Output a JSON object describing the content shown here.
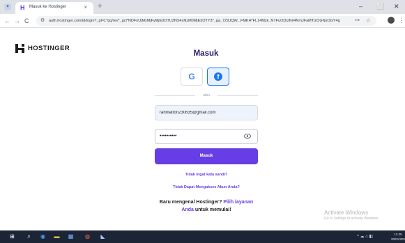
{
  "browser": {
    "tab_title": "Masuk ke Hostinger",
    "tab_close": "×",
    "new_tab": "+",
    "url": "auth.hostinger.com/id/login?_gl=1*gq/rev*_gcl*NDFnUjMxMjFyMjE0OTU3NS4xNzM0MjE3OTY3*_ga_7Z9JQW...FMKH*FL14Mzk..NTFuODIzNiI4NmJFaMTlzOGNsOGY4g",
    "minimize": "–",
    "maximize": "⬜",
    "close": "✕",
    "back": "←",
    "forward": "→",
    "reload": "C",
    "site_info": "⚙",
    "key": "⊶",
    "star": "☆",
    "menu": "⋮"
  },
  "page": {
    "logo_text": "HOSTINGER",
    "heading": "Masuk",
    "google_letter": "G",
    "facebook_letter": "f",
    "divider_text": "atau",
    "email_value": "rahmatfon230635@gmail.com",
    "password_value": "••••••••••",
    "submit_label": "Masuk",
    "forgot_link": "Tidak ingat kata sandi?",
    "access_link": "Tidak Dapat Mengakses Akun Anda?",
    "signup_prefix": "Baru mengenal Hostinger?",
    "signup_link_1": "Pilih layanan",
    "signup_link_2": "Anda",
    "signup_suffix": "untuk memulai!"
  },
  "watermark": {
    "title": "Activate Windows",
    "subtitle": "Go to Settings to activate Windows."
  },
  "taskbar": {
    "clock_time": "13.25",
    "clock_date": "20/01/2025",
    "tray_icons": "^ ☁ ⌂ ◧"
  },
  "colors": {
    "brand": "#673de6",
    "heading": "#2f1c6a",
    "facebook": "#1877f2",
    "taskbar": "#1c2536"
  }
}
